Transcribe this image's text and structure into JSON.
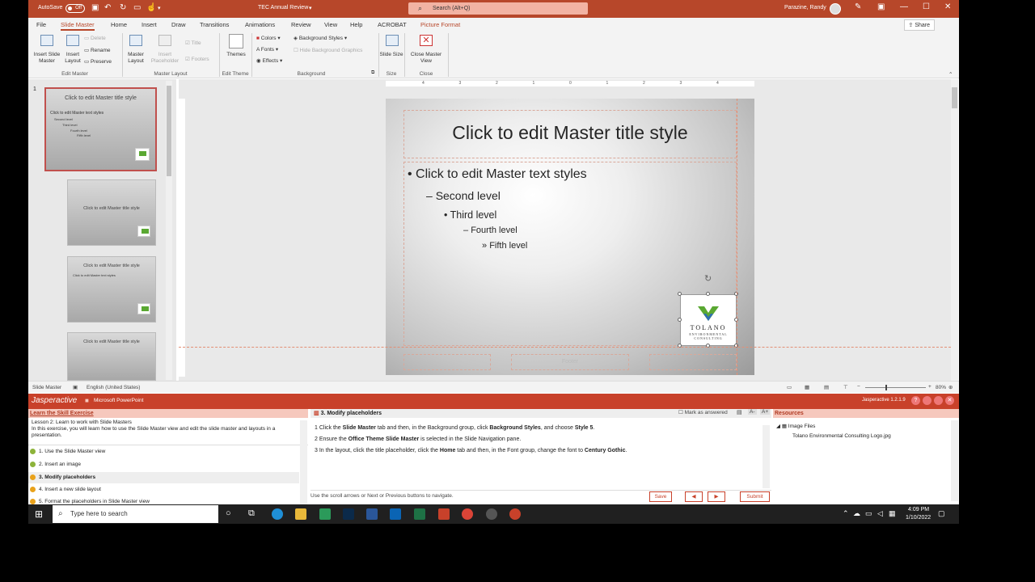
{
  "titlebar": {
    "autosave_label": "AutoSave",
    "autosave_state": "Off",
    "doc_title": "TEC Annual Review",
    "search_placeholder": "Search (Alt+Q)",
    "user_name": "Parazine, Randy"
  },
  "ribbon": {
    "tabs": [
      "File",
      "Slide Master",
      "Home",
      "Insert",
      "Draw",
      "Transitions",
      "Animations",
      "Review",
      "View",
      "Help",
      "ACROBAT",
      "Picture Format"
    ],
    "share_label": "Share",
    "buttons": {
      "insert_slide_master": "Insert Slide Master",
      "insert_layout": "Insert Layout",
      "delete": "Delete",
      "rename": "Rename",
      "preserve": "Preserve",
      "master_layout": "Master Layout",
      "insert_placeholder": "Insert Placeholder",
      "title": "Title",
      "footers": "Footers",
      "themes": "Themes",
      "colors": "Colors",
      "fonts": "Fonts",
      "effects": "Effects",
      "background_styles": "Background Styles",
      "hide_background_graphics": "Hide Background Graphics",
      "slide_size": "Slide Size",
      "close_master_view": "Close Master View"
    },
    "groups": {
      "edit_master": "Edit Master",
      "master_layout": "Master Layout",
      "edit_theme": "Edit Theme",
      "background": "Background",
      "size": "Size",
      "close": "Close"
    }
  },
  "thumbnails": {
    "slide_number": "1",
    "master_title": "Click to edit Master title style",
    "master_text": "Click to edit Master text styles",
    "second": "Second level",
    "third": "Third level",
    "fourth": "Fourth level",
    "fifth": "Fifth level"
  },
  "slide": {
    "title": "Click to edit Master title style",
    "level1": "Click to edit Master text styles",
    "level2": "Second level",
    "level3": "Third level",
    "level4": "Fourth level",
    "level5": "Fifth level",
    "footer": "Footer",
    "logo_name": "TOLANO",
    "logo_sub1": "ENVIRONMENTAL",
    "logo_sub2": "CONSULTING"
  },
  "ruler_ticks": [
    "4",
    "3",
    "2",
    "1",
    "0",
    "1",
    "2",
    "3",
    "4"
  ],
  "statusbar": {
    "view": "Slide Master",
    "language": "English (United States)",
    "zoom": "80%"
  },
  "jasperactive": {
    "brand": "Jasperactive",
    "product": "Microsoft PowerPoint",
    "version": "Jasperactive 1.2.1.9",
    "learn_header": "Learn the Skill Exercise",
    "lesson_title": "Lesson 2: Learn to work with Slide Masters",
    "lesson_desc": "In this exercise, you will learn how to use the Slide Master view and edit the slide master and layouts in a presentation.",
    "steps": [
      "1. Use the Slide Master view",
      "2. Insert an image",
      "3. Modify placeholders",
      "4. Insert a new slide layout",
      "5. Format the placeholders in Slide Master view"
    ],
    "current_task": "3. Modify placeholders",
    "mark_answered": "Mark as answered",
    "font_minus": "A-",
    "font_plus": "A+",
    "instr1": {
      "n": "1",
      "a": "Click the ",
      "b": "Slide Master",
      "c": " tab and then, in the Background group, click ",
      "d": "Background Styles",
      "e": ", and choose ",
      "f": "Style 5",
      "g": "."
    },
    "instr2": {
      "n": "2",
      "a": "Ensure the ",
      "b": "Office Theme Slide Master",
      "c": " is selected in the Slide Navigation pane."
    },
    "instr3": {
      "n": "3",
      "a": "In the layout, click the title placeholder, click the ",
      "b": "Home",
      "c": " tab and then, in the Font group, change the font to ",
      "d": "Century Gothic",
      "e": "."
    },
    "nav_hint": "Use the scroll arrows or Next or Previous buttons to navigate.",
    "save": "Save",
    "submit": "Submit",
    "resources_header": "Resources",
    "image_files": "Image Files",
    "resource_file": "Tolano Environmental Consulting Logo.jpg"
  },
  "taskbar": {
    "search_placeholder": "Type here to search",
    "time": "4:09 PM",
    "date": "1/10/2022"
  },
  "colors": {
    "accent": "#b7472a",
    "jasper": "#c8412a",
    "logo_green": "#5aa832",
    "logo_blue": "#2f6db5"
  }
}
